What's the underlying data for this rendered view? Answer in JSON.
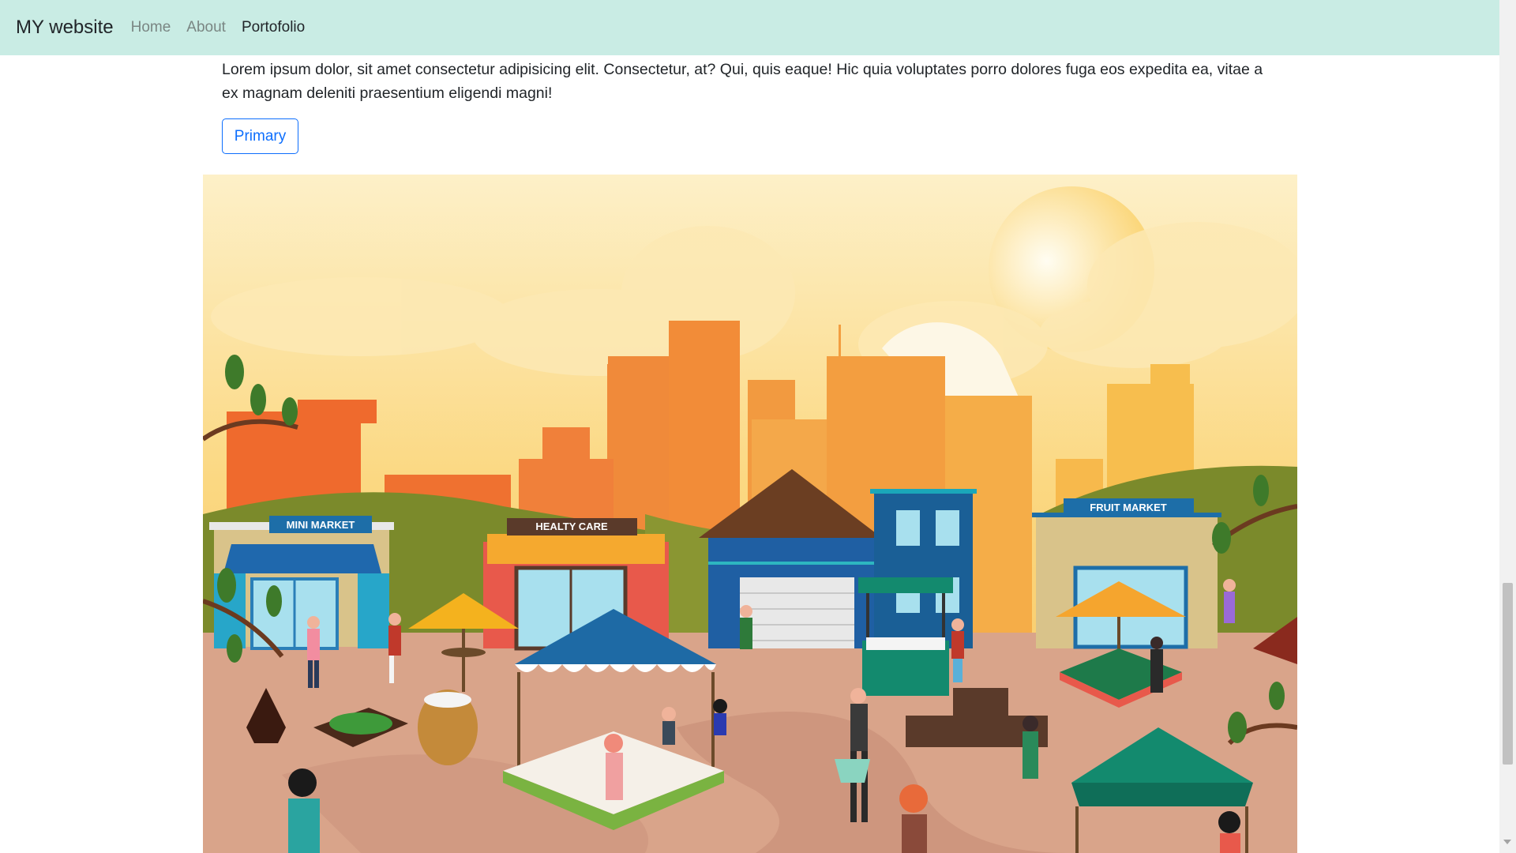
{
  "navbar": {
    "brand": "MY website",
    "links": [
      {
        "label": "Home",
        "active": false
      },
      {
        "label": "About",
        "active": false
      },
      {
        "label": "Portofolio",
        "active": true
      }
    ],
    "background": "#c9ece4"
  },
  "main": {
    "paragraph": "Lorem ipsum dolor, sit amet consectetur adipisicing elit. Consectetur, at? Qui, quis eaque! Hic quia voluptates porro dolores fuga eos expedita ea, vitae a ex magnam deleniti praesentium eligendi magni!",
    "primary_button": "Primary"
  },
  "hero_image": {
    "signs": {
      "mini_market": "MINI MARKET",
      "healty_care": "HEALTY CARE",
      "fruit_market": "FRUIT MARKET"
    }
  },
  "colors": {
    "primary": "#0d6efd"
  }
}
